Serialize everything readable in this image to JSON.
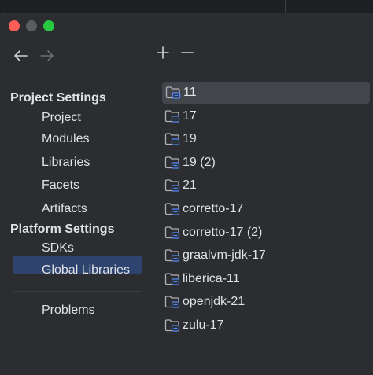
{
  "nav": {
    "back_icon": "arrow-left-icon",
    "forward_icon": "arrow-right-icon"
  },
  "sidebar": {
    "project_settings_title": "Project Settings",
    "project_items": [
      "Project",
      "Modules",
      "Libraries",
      "Facets",
      "Artifacts"
    ],
    "platform_settings_title": "Platform Settings",
    "platform_items": [
      "SDKs",
      "Global Libraries"
    ],
    "selected_item": "SDKs",
    "other_items": [
      "Problems"
    ]
  },
  "toolbar": {
    "add_icon": "plus-icon",
    "remove_icon": "minus-icon"
  },
  "sdks": {
    "items": [
      "11",
      "17",
      "19",
      "19 (2)",
      "21",
      "corretto-17",
      "corretto-17 (2)",
      "graalvm-jdk-17",
      "liberica-11",
      "openjdk-21",
      "zulu-17"
    ],
    "selected": "11",
    "icon": "sdk-folder-icon"
  },
  "colors": {
    "background": "#2b2d30",
    "selection_sidebar": "#2e436e",
    "selection_list": "#43454a",
    "folder_badge": "#548af7",
    "close": "#ff5f57",
    "zoom": "#28c840"
  }
}
